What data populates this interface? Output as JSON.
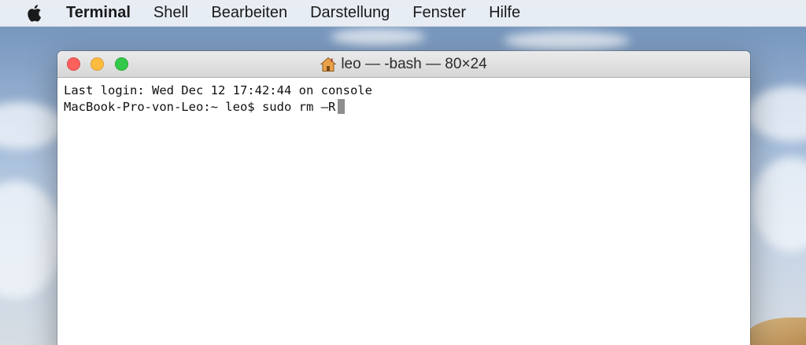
{
  "menubar": {
    "apple_icon": "apple-logo-icon",
    "app_name": "Terminal",
    "items": [
      "Shell",
      "Bearbeiten",
      "Darstellung",
      "Fenster",
      "Hilfe"
    ]
  },
  "window": {
    "title_icon": "home-icon",
    "title": "leo — -bash — 80×24",
    "traffic_lights": {
      "close_color": "#fc615d",
      "minimize_color": "#fdbc40",
      "zoom_color": "#34c84a"
    }
  },
  "terminal": {
    "lines": [
      "Last login: Wed Dec 12 17:42:44 on console",
      "MacBook-Pro-von-Leo:~ leo$ sudo rm —R"
    ],
    "cursor_color": "#8e8e8e"
  }
}
